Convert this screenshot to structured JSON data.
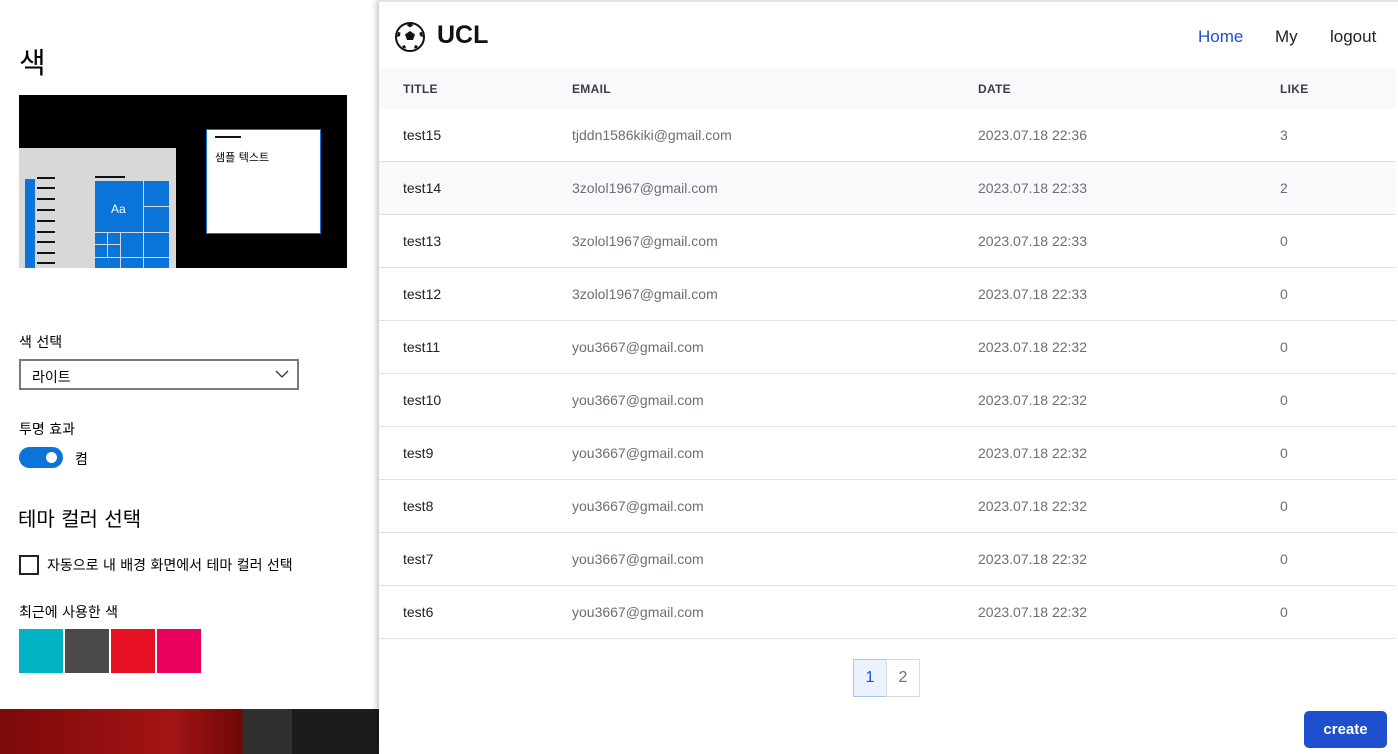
{
  "settings": {
    "title": "색",
    "preview_sample_text": "샘플 텍스트",
    "preview_tile_text": "Aa",
    "color_select_label": "색 선택",
    "color_select_value": "라이트",
    "transparency_label": "투명 효과",
    "transparency_state": "켬",
    "transparency_on": true,
    "theme_color_heading": "테마 컬러 선택",
    "auto_theme_label": "자동으로 내 배경 화면에서 테마 컬러 선택",
    "auto_theme_checked": false,
    "recent_colors_label": "최근에 사용한 색",
    "recent_colors": [
      "#00b4c4",
      "#4c4a48",
      "#e81123",
      "#ea005e"
    ],
    "accent": "#0a74d8"
  },
  "app": {
    "brand": "UCL",
    "nav": [
      {
        "label": "Home",
        "active": true
      },
      {
        "label": "My",
        "active": false
      },
      {
        "label": "logout",
        "active": false
      }
    ],
    "columns": [
      "TITLE",
      "EMAIL",
      "DATE",
      "LIKE"
    ],
    "rows": [
      {
        "title": "test15",
        "email": "tjddn1586kiki@gmail.com",
        "date": "2023.07.18 22:36",
        "like": "3"
      },
      {
        "title": "test14",
        "email": "3zolol1967@gmail.com",
        "date": "2023.07.18 22:33",
        "like": "2"
      },
      {
        "title": "test13",
        "email": "3zolol1967@gmail.com",
        "date": "2023.07.18 22:33",
        "like": "0"
      },
      {
        "title": "test12",
        "email": "3zolol1967@gmail.com",
        "date": "2023.07.18 22:33",
        "like": "0"
      },
      {
        "title": "test11",
        "email": "you3667@gmail.com",
        "date": "2023.07.18 22:32",
        "like": "0"
      },
      {
        "title": "test10",
        "email": "you3667@gmail.com",
        "date": "2023.07.18 22:32",
        "like": "0"
      },
      {
        "title": "test9",
        "email": "you3667@gmail.com",
        "date": "2023.07.18 22:32",
        "like": "0"
      },
      {
        "title": "test8",
        "email": "you3667@gmail.com",
        "date": "2023.07.18 22:32",
        "like": "0"
      },
      {
        "title": "test7",
        "email": "you3667@gmail.com",
        "date": "2023.07.18 22:32",
        "like": "0"
      },
      {
        "title": "test6",
        "email": "you3667@gmail.com",
        "date": "2023.07.18 22:32",
        "like": "0"
      }
    ],
    "pages": [
      "1",
      "2"
    ],
    "current_page": "1",
    "create_label": "create",
    "brand_color": "#1d4fcf"
  }
}
